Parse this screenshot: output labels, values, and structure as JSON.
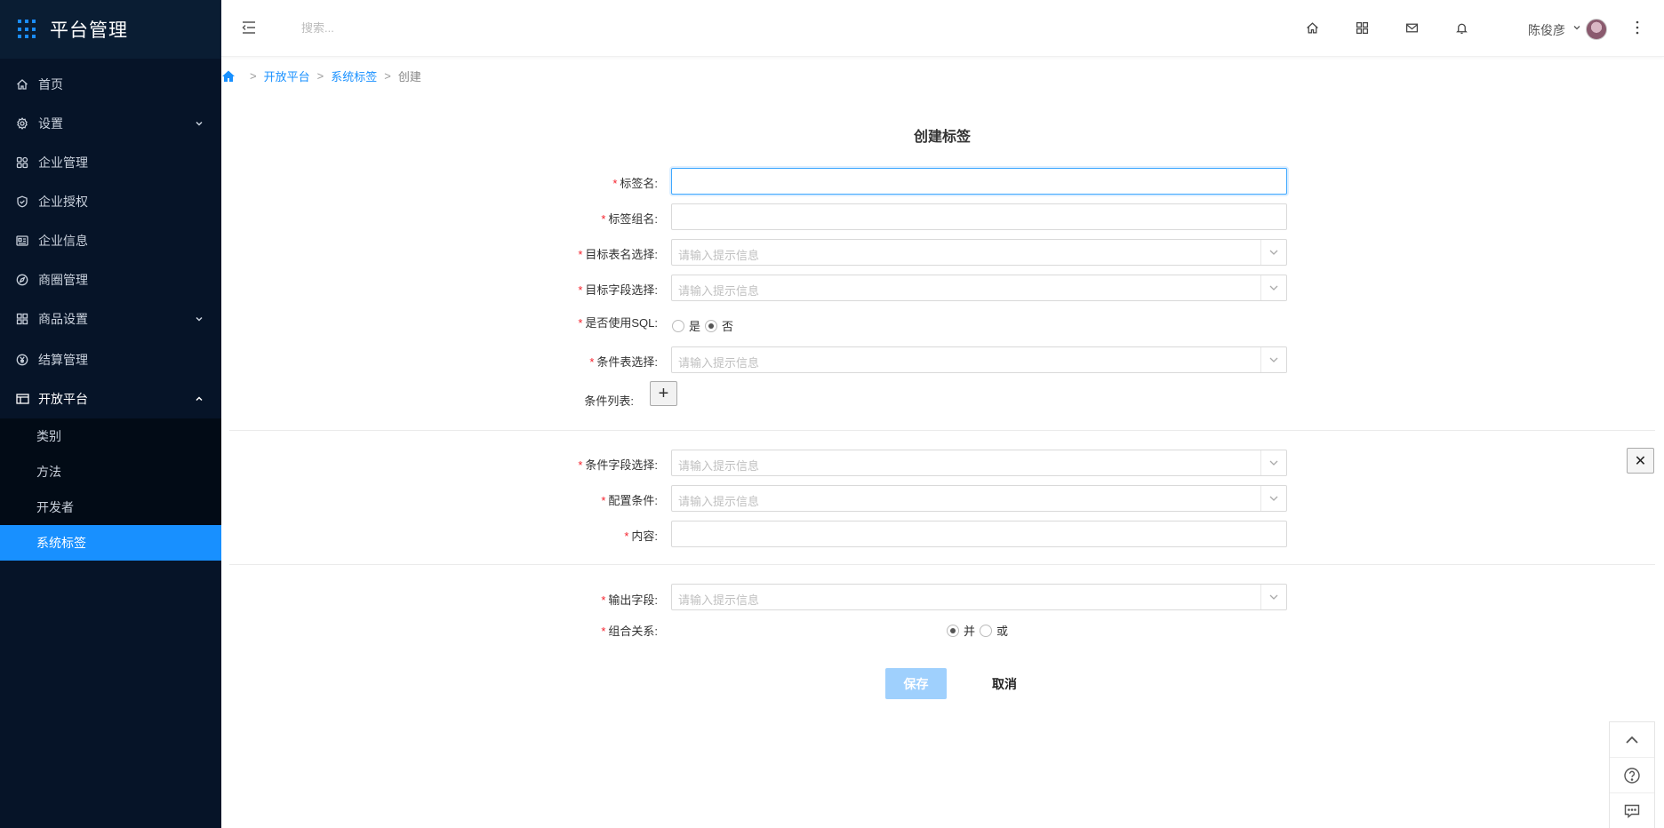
{
  "brand": {
    "title": "平台管理",
    "icon": "grid-dots-icon"
  },
  "sidebar": {
    "items": [
      {
        "label": "首页",
        "icon": "home-icon"
      },
      {
        "label": "设置",
        "icon": "gear-icon",
        "has_caret": true
      },
      {
        "label": "企业管理",
        "icon": "apps-icon"
      },
      {
        "label": "企业授权",
        "icon": "shield-check-icon"
      },
      {
        "label": "企业信息",
        "icon": "id-card-icon"
      },
      {
        "label": "商圈管理",
        "icon": "compass-icon"
      },
      {
        "label": "商品设置",
        "icon": "grid-icon",
        "has_caret": true
      },
      {
        "label": "结算管理",
        "icon": "yen-circle-icon"
      },
      {
        "label": "开放平台",
        "icon": "table-icon",
        "has_caret": true,
        "open": true
      }
    ],
    "subitems": [
      {
        "label": "类别"
      },
      {
        "label": "方法"
      },
      {
        "label": "开发者"
      },
      {
        "label": "系统标签",
        "active": true
      }
    ]
  },
  "header": {
    "search_placeholder": "搜索...",
    "user_name": "陈俊彦",
    "icons": [
      "home-icon",
      "apps-icon",
      "mail-icon",
      "bell-icon",
      "more-vertical-icon"
    ]
  },
  "breadcrumb": {
    "items": [
      "开放平台",
      "系统标签"
    ],
    "current": "创建"
  },
  "form": {
    "title": "创建标签",
    "fields": {
      "tag_name": {
        "label": "标签名:",
        "value": ""
      },
      "tag_group": {
        "label": "标签组名:",
        "value": ""
      },
      "target_table": {
        "label": "目标表名选择:",
        "placeholder": "请输入提示信息"
      },
      "target_field": {
        "label": "目标字段选择:",
        "placeholder": "请输入提示信息"
      },
      "use_sql": {
        "label": "是否使用SQL:",
        "options": [
          "是",
          "否"
        ],
        "selected": "否"
      },
      "condition_table": {
        "label": "条件表选择:",
        "placeholder": "请输入提示信息"
      },
      "condition_list": {
        "label": "条件列表:",
        "add_symbol": "+"
      },
      "condition_field": {
        "label": "条件字段选择:",
        "placeholder": "请输入提示信息"
      },
      "config_condition": {
        "label": "配置条件:",
        "placeholder": "请输入提示信息"
      },
      "content": {
        "label": "内容:",
        "value": ""
      },
      "output_field": {
        "label": "输出字段:",
        "placeholder": "请输入提示信息"
      },
      "combine_relation": {
        "label": "组合关系:",
        "options": [
          "并",
          "或"
        ],
        "selected": "并"
      }
    },
    "remove_symbol": "✕",
    "save_label": "保存",
    "cancel_label": "取消"
  },
  "float_tools": [
    "arrow-up-icon",
    "help-icon",
    "chat-icon"
  ],
  "colors": {
    "sidebar_bg": "#061428",
    "accent": "#1890ff",
    "required": "#f5222d",
    "save_disabled": "#9fd0fd"
  }
}
